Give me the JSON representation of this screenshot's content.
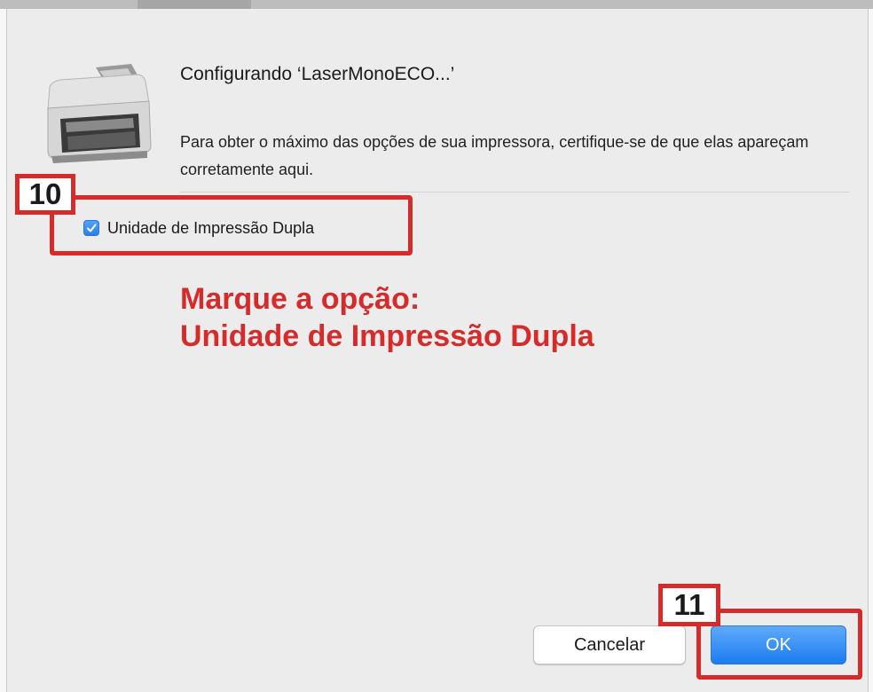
{
  "dialog": {
    "title": "Configurando ‘LaserMonoECO...’",
    "description": "Para obter o máximo das opções de sua impressora, certifique-se de que elas apareçam corretamente aqui.",
    "option": {
      "label": "Unidade de Impressão Dupla",
      "checked": true
    },
    "buttons": {
      "cancel_label": "Cancelar",
      "ok_label": "OK"
    }
  },
  "annotations": {
    "step_10": "10",
    "step_11": "11",
    "instruction_line1": "Marque a opção:",
    "instruction_line2": "Unidade de Impressão Dupla",
    "color": "#d62b2b"
  },
  "icons": {
    "printer": "printer-icon",
    "checkmark": "checkmark-icon"
  },
  "colors": {
    "accent": "#2d7fe8",
    "dialog_background": "#ececec"
  }
}
